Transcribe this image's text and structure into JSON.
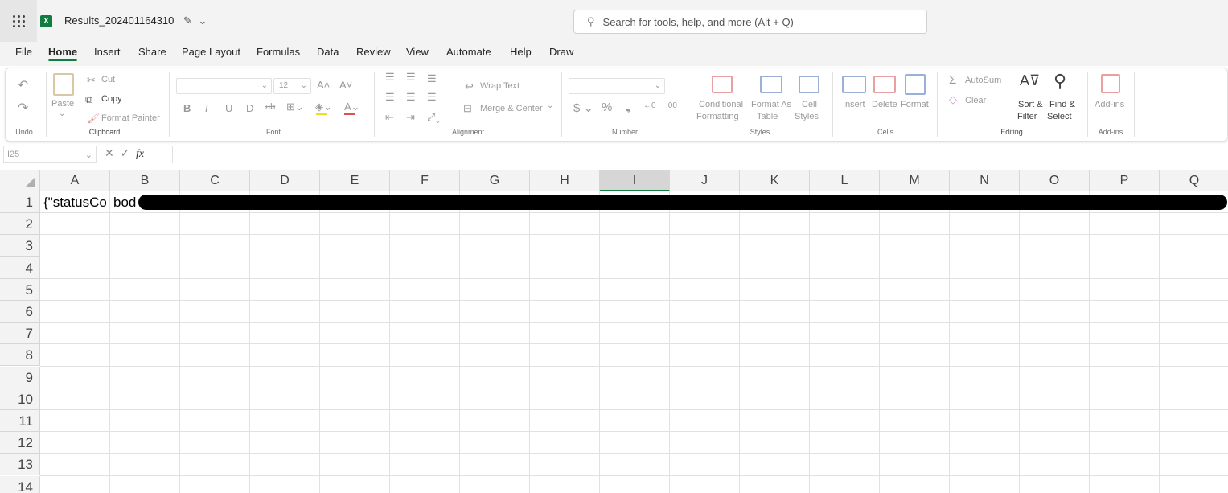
{
  "app": {
    "file_name": "Results_202401164310",
    "logo_letter": "X"
  },
  "search": {
    "placeholder": "Search for tools, help, and more (Alt + Q)"
  },
  "tabs": [
    "File",
    "Home",
    "Insert",
    "Share",
    "Page Layout",
    "Formulas",
    "Data",
    "Review",
    "View",
    "Automate",
    "Help",
    "Draw"
  ],
  "active_tab": "Home",
  "ribbon": {
    "undo_group": "Undo",
    "clipboard": {
      "paste": "Paste",
      "cut": "Cut",
      "copy": "Copy",
      "format_painter": "Format Painter",
      "label": "Clipboard"
    },
    "font": {
      "size": "12",
      "label": "Font"
    },
    "alignment": {
      "wrap_text": "Wrap Text",
      "merge_center": "Merge & Center",
      "label": "Alignment"
    },
    "number": {
      "label": "Number"
    },
    "styles": {
      "conditional_1": "Conditional",
      "conditional_2": "Formatting",
      "format_table_1": "Format As",
      "format_table_2": "Table",
      "cell_styles_1": "Cell",
      "cell_styles_2": "Styles",
      "label": "Styles"
    },
    "cells": {
      "insert": "Insert",
      "delete": "Delete",
      "format": "Format",
      "label": "Cells"
    },
    "editing": {
      "autosum": "AutoSum",
      "clear": "Clear",
      "sort_1": "Sort &",
      "sort_2": "Filter",
      "find_1": "Find &",
      "find_2": "Select",
      "label": "Editing"
    },
    "addins": {
      "button": "Add-ins",
      "label": "Add-ins"
    }
  },
  "formula_bar": {
    "name_box": "I25",
    "fx": "fx",
    "value": ""
  },
  "columns": [
    "A",
    "B",
    "C",
    "D",
    "E",
    "F",
    "G",
    "H",
    "I",
    "J",
    "K",
    "L",
    "M",
    "N",
    "O",
    "P",
    "Q"
  ],
  "selected_column": "I",
  "rows": [
    "1",
    "2",
    "3",
    "4",
    "5",
    "6",
    "7",
    "8",
    "9",
    "10",
    "11",
    "12",
    "13",
    "14"
  ],
  "cells": {
    "A1": "{\"statusCo",
    "B1": "bod"
  },
  "colors": {
    "accent": "#107c41",
    "redaction": "#000000"
  }
}
